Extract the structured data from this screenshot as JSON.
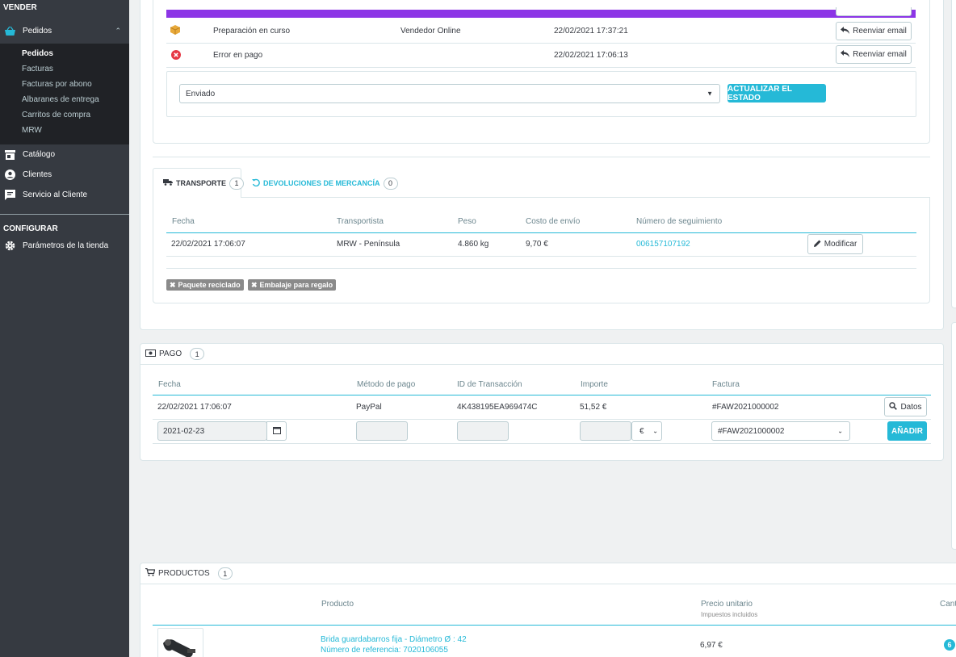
{
  "sidebar": {
    "sell_title": "VENDER",
    "orders_label": "Pedidos",
    "sub_items": [
      "Pedidos",
      "Facturas",
      "Facturas por abono",
      "Albaranes de entrega",
      "Carritos de compra",
      "MRW"
    ],
    "catalog_label": "Catálogo",
    "customers_label": "Clientes",
    "service_label": "Servicio al Cliente",
    "configure_title": "CONFIGURAR",
    "shop_params_label": "Parámetros de la tienda"
  },
  "status_history": {
    "rows": [
      {
        "status": "Preparación en curso",
        "employee": "Vendedor Online",
        "date": "22/02/2021 17:37:21",
        "action": "Reenviar email"
      },
      {
        "status": "Error en pago",
        "employee": "",
        "date": "22/02/2021 17:06:13",
        "action": "Reenviar email"
      }
    ],
    "select_value": "Enviado",
    "update_button": "ACTUALIZAR EL ESTADO"
  },
  "shipping": {
    "tab_transport": "TRANSPORTE",
    "tab_transport_count": "1",
    "tab_returns": "DEVOLUCIONES DE MERCANCÍA",
    "tab_returns_count": "0",
    "headers": [
      "Fecha",
      "Transportista",
      "Peso",
      "Costo de envío",
      "Número de seguimiento"
    ],
    "row": {
      "date": "22/02/2021 17:06:07",
      "carrier": "MRW - Península",
      "weight": "4.860 kg",
      "cost": "9,70 €",
      "tracking": "006157107192",
      "action": "Modificar"
    },
    "tags": [
      "Paquete reciclado",
      "Embalaje para regalo"
    ]
  },
  "payment": {
    "title": "PAGO",
    "count": "1",
    "headers": [
      "Fecha",
      "Método de pago",
      "ID de Transacción",
      "Importe",
      "Factura"
    ],
    "row": {
      "date": "22/02/2021 17:06:07",
      "method": "PayPal",
      "transaction_id": "4K438195EA969474C",
      "amount": "51,52 €",
      "invoice": "#FAW2021000002",
      "action": "Datos"
    },
    "form": {
      "date_value": "2021-02-23",
      "currency": "€",
      "invoice_select": "#FAW2021000002",
      "add_button": "AÑADIR"
    }
  },
  "products": {
    "title": "PRODUCTOS",
    "count": "1",
    "header_product": "Producto",
    "header_price": "Precio unitario",
    "header_price_note": "Impuestos incluidos",
    "header_qty": "Cant",
    "item": {
      "name": "Brida guardabarros fija - Diámetro Ø : 42",
      "reference": "Número de referencia: 7020106055",
      "price": "6,97 €",
      "qty": "6"
    }
  }
}
